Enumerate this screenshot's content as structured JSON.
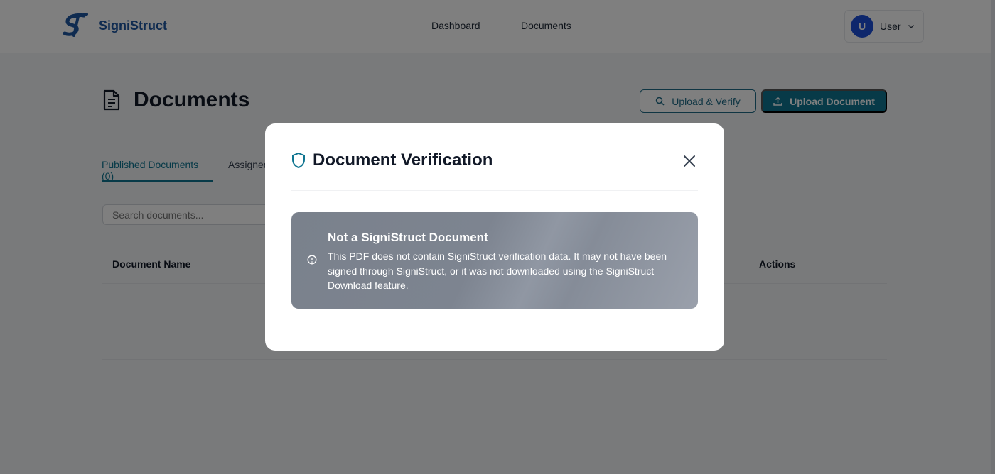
{
  "app": {
    "brand_name": "SigniStruct",
    "colors": {
      "brand": "#1e56a0",
      "accent": "#0e7490",
      "avatar": "#1d4ed8"
    }
  },
  "nav": {
    "items": [
      {
        "label": "Dashboard"
      },
      {
        "label": "Documents"
      }
    ]
  },
  "user": {
    "initial": "U",
    "name": "User"
  },
  "page": {
    "title": "Documents",
    "buttons": {
      "verify_label": "Upload & Verify",
      "upload_label": "Upload Document"
    },
    "tabs": [
      {
        "label": "Published Documents (0)",
        "active": true
      },
      {
        "label": "Assigned"
      }
    ],
    "search": {
      "placeholder": "Search documents..."
    },
    "table": {
      "columns": [
        "Document Name",
        "Actions"
      ]
    }
  },
  "modal": {
    "title": "Document Verification",
    "alert": {
      "title": "Not a SigniStruct Document",
      "body": "This PDF does not contain SigniStruct verification data. It may not have been signed through SigniStruct, or it was not downloaded using the SigniStruct Download feature."
    }
  },
  "icons": [
    "signistruct-logo",
    "chevron-down-icon",
    "document-icon",
    "search-icon",
    "upload-icon",
    "shield-icon",
    "close-icon",
    "info-icon"
  ]
}
